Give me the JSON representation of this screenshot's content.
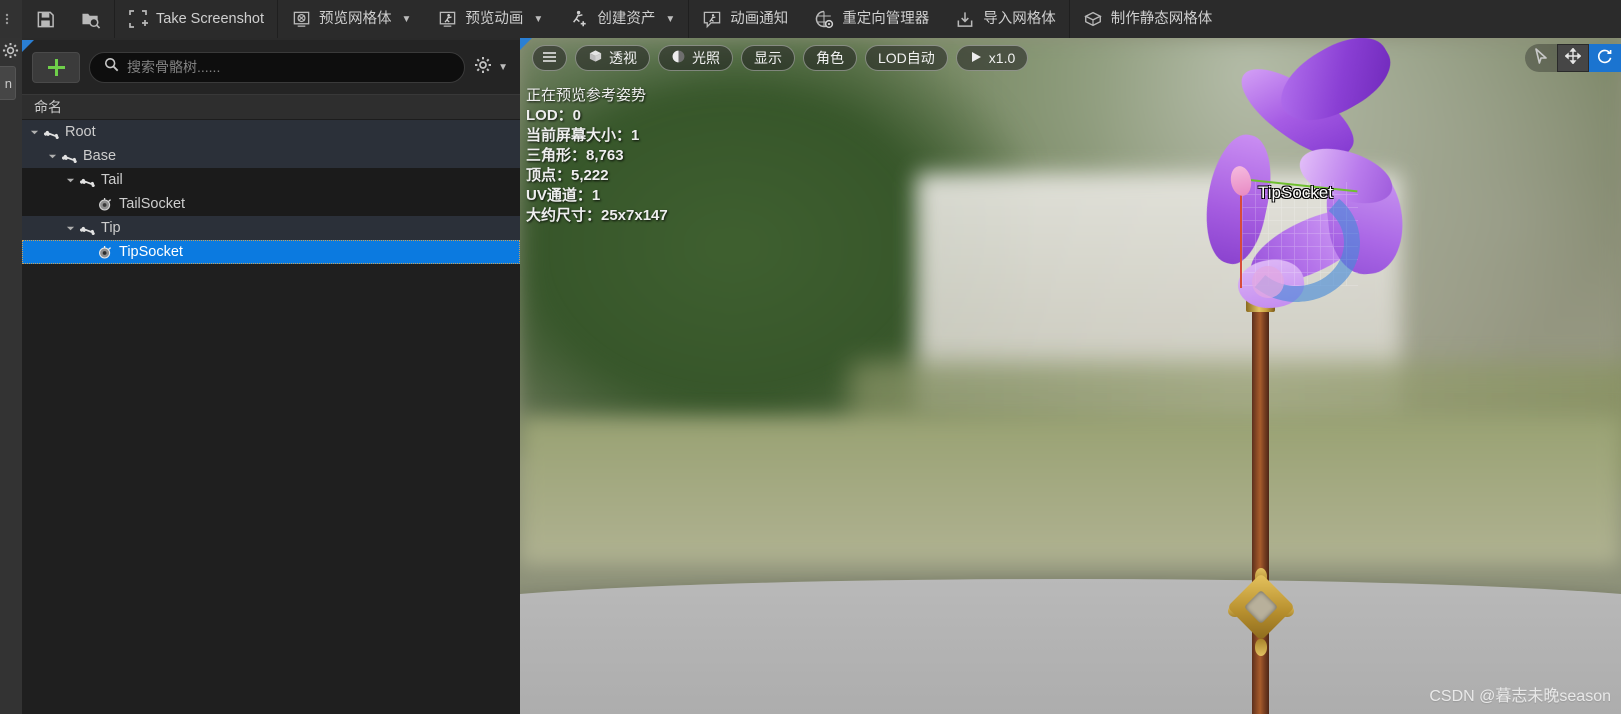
{
  "toolbar": {
    "groups": [
      {
        "items": [
          {
            "name": "save-button",
            "icon": "save-icon",
            "label": ""
          },
          {
            "name": "browse-asset-button",
            "icon": "folder-search-icon",
            "label": ""
          }
        ]
      },
      {
        "items": [
          {
            "name": "take-screenshot-button",
            "icon": "screenshot-frame-icon",
            "label": "Take Screenshot"
          }
        ]
      },
      {
        "items": [
          {
            "name": "preview-mesh-button",
            "icon": "mesh-icon",
            "label": "预览网格体",
            "caret": true
          },
          {
            "name": "preview-animation-button",
            "icon": "animation-icon",
            "label": "预览动画",
            "caret": true
          },
          {
            "name": "create-asset-button",
            "icon": "create-asset-icon",
            "label": "创建资产",
            "caret": true
          }
        ]
      },
      {
        "items": [
          {
            "name": "anim-notify-button",
            "icon": "notify-bubble-icon",
            "label": "动画通知"
          },
          {
            "name": "retarget-manager-button",
            "icon": "retarget-icon",
            "label": "重定向管理器"
          },
          {
            "name": "import-mesh-button",
            "icon": "import-icon",
            "label": "导入网格体"
          }
        ]
      },
      {
        "items": [
          {
            "name": "make-static-mesh-button",
            "icon": "static-mesh-icon",
            "label": "制作静态网格体"
          }
        ]
      }
    ]
  },
  "left_rail": {
    "gear_icon": "gear-icon",
    "tab_label": "n"
  },
  "skeleton_panel": {
    "add_button_label": "+",
    "search": {
      "placeholder": "搜索骨骼树......",
      "value": ""
    },
    "settings_icon": "gear-icon",
    "settings_caret": "chevron-down-icon",
    "column_header": "命名",
    "tree": [
      {
        "label": "Root",
        "depth": 0,
        "type": "bone",
        "expanded": true,
        "selected": false,
        "stripe": "alt"
      },
      {
        "label": "Base",
        "depth": 1,
        "type": "bone",
        "expanded": true,
        "selected": false,
        "stripe": "alt"
      },
      {
        "label": "Tail",
        "depth": 2,
        "type": "bone",
        "expanded": true,
        "selected": false,
        "stripe": "dark"
      },
      {
        "label": "TailSocket",
        "depth": 3,
        "type": "socket",
        "expanded": false,
        "selected": false,
        "stripe": "dark"
      },
      {
        "label": "Tip",
        "depth": 2,
        "type": "bone",
        "expanded": true,
        "selected": false,
        "stripe": "alt"
      },
      {
        "label": "TipSocket",
        "depth": 3,
        "type": "socket",
        "expanded": false,
        "selected": true,
        "stripe": "sel"
      }
    ]
  },
  "viewport": {
    "toolbar": [
      {
        "name": "viewport-menu-button",
        "icon": "hamburger-icon",
        "label": ""
      },
      {
        "name": "view-mode-perspective-button",
        "icon": "cube-icon",
        "label": "透视"
      },
      {
        "name": "view-mode-lit-button",
        "icon": "sphere-lit-icon",
        "label": "光照"
      },
      {
        "name": "show-flags-button",
        "icon": "",
        "label": "显示"
      },
      {
        "name": "character-button",
        "icon": "",
        "label": "角色"
      },
      {
        "name": "lod-button",
        "icon": "",
        "label": "LOD自动"
      },
      {
        "name": "playback-speed-button",
        "icon": "play-icon",
        "label": "x1.0"
      }
    ],
    "right_tools": [
      {
        "name": "select-tool-button",
        "icon": "cursor-arrow-icon",
        "active": false
      },
      {
        "name": "move-tool-button",
        "icon": "move-gizmo-icon",
        "active": false
      },
      {
        "name": "rotate-tool-button",
        "icon": "rotate-gizmo-icon",
        "active": true
      }
    ],
    "stats": [
      "正在预览参考姿势",
      "LOD：0",
      "当前屏幕大小：1",
      "三角形：8,763",
      "顶点：5,222",
      "UV通道：1",
      "大约尺寸：25x7x147"
    ],
    "socket_label": "TipSocket",
    "watermark": "CSDN @暮志未晚season"
  },
  "colors": {
    "selection_blue": "#0b7ae0",
    "accent_green": "#6fcf4a",
    "panel_bg": "#242424",
    "toolbar_bg": "#2b2b2b",
    "gizmo_x": "#6fbf2f",
    "gizmo_y": "#d74b3a",
    "gizmo_arc": "#488cd8"
  }
}
